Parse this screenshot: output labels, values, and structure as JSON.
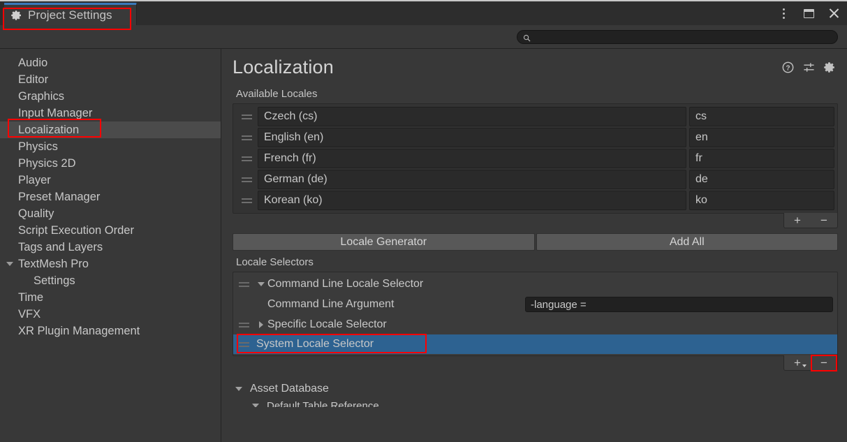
{
  "window": {
    "tab_title": "Project Settings",
    "tab_icon": "gear-icon",
    "controls": [
      {
        "name": "more-options-icon",
        "label": "⋮"
      },
      {
        "name": "restore-window-icon",
        "label": ""
      },
      {
        "name": "close-window-icon",
        "label": "✕"
      }
    ]
  },
  "search": {
    "placeholder": "",
    "value": "",
    "icon": "search-icon"
  },
  "sidebar": {
    "items": [
      {
        "label": "Audio",
        "selected": false,
        "indent": false,
        "expander": null
      },
      {
        "label": "Editor",
        "selected": false,
        "indent": false,
        "expander": null
      },
      {
        "label": "Graphics",
        "selected": false,
        "indent": false,
        "expander": null
      },
      {
        "label": "Input Manager",
        "selected": false,
        "indent": false,
        "expander": null
      },
      {
        "label": "Localization",
        "selected": true,
        "indent": false,
        "expander": null
      },
      {
        "label": "Physics",
        "selected": false,
        "indent": false,
        "expander": null
      },
      {
        "label": "Physics 2D",
        "selected": false,
        "indent": false,
        "expander": null
      },
      {
        "label": "Player",
        "selected": false,
        "indent": false,
        "expander": null
      },
      {
        "label": "Preset Manager",
        "selected": false,
        "indent": false,
        "expander": null
      },
      {
        "label": "Quality",
        "selected": false,
        "indent": false,
        "expander": null
      },
      {
        "label": "Script Execution Order",
        "selected": false,
        "indent": false,
        "expander": null
      },
      {
        "label": "Tags and Layers",
        "selected": false,
        "indent": false,
        "expander": null
      },
      {
        "label": "TextMesh Pro",
        "selected": false,
        "indent": false,
        "expander": "down"
      },
      {
        "label": "Settings",
        "selected": false,
        "indent": true,
        "expander": null
      },
      {
        "label": "Time",
        "selected": false,
        "indent": false,
        "expander": null
      },
      {
        "label": "VFX",
        "selected": false,
        "indent": false,
        "expander": null
      },
      {
        "label": "XR Plugin Management",
        "selected": false,
        "indent": false,
        "expander": null
      }
    ]
  },
  "main": {
    "title": "Localization",
    "header_icons": [
      {
        "name": "help-icon"
      },
      {
        "name": "preset-sliders-icon"
      },
      {
        "name": "settings-gear-icon"
      }
    ],
    "available_locales": {
      "label": "Available Locales",
      "rows": [
        {
          "name": "Czech (cs)",
          "code": "cs"
        },
        {
          "name": "English (en)",
          "code": "en"
        },
        {
          "name": "French (fr)",
          "code": "fr"
        },
        {
          "name": "German (de)",
          "code": "de"
        },
        {
          "name": "Korean (ko)",
          "code": "ko"
        }
      ],
      "add_label": "+",
      "remove_label": "−"
    },
    "buttons": {
      "locale_generator": "Locale Generator",
      "add_all": "Add All"
    },
    "locale_selectors": {
      "label": "Locale Selectors",
      "rows": [
        {
          "label": "Command Line Locale Selector",
          "expander": "down",
          "selected": false,
          "handle": true
        },
        {
          "label": "Specific Locale Selector",
          "expander": "right",
          "selected": false,
          "handle": true
        },
        {
          "label": "System Locale Selector",
          "expander": null,
          "selected": true,
          "handle": true
        }
      ],
      "property": {
        "label": "Command Line Argument",
        "value": "-language ="
      },
      "add_label": "+",
      "remove_label": "−"
    },
    "asset_database": {
      "label": "Asset Database",
      "child_label": "Default Table Reference"
    }
  },
  "colors": {
    "selection_blue": "#2d6291",
    "tab_accent": "#3a79bb",
    "annotation_red": "#ff0000",
    "panel_bg": "#383838"
  }
}
